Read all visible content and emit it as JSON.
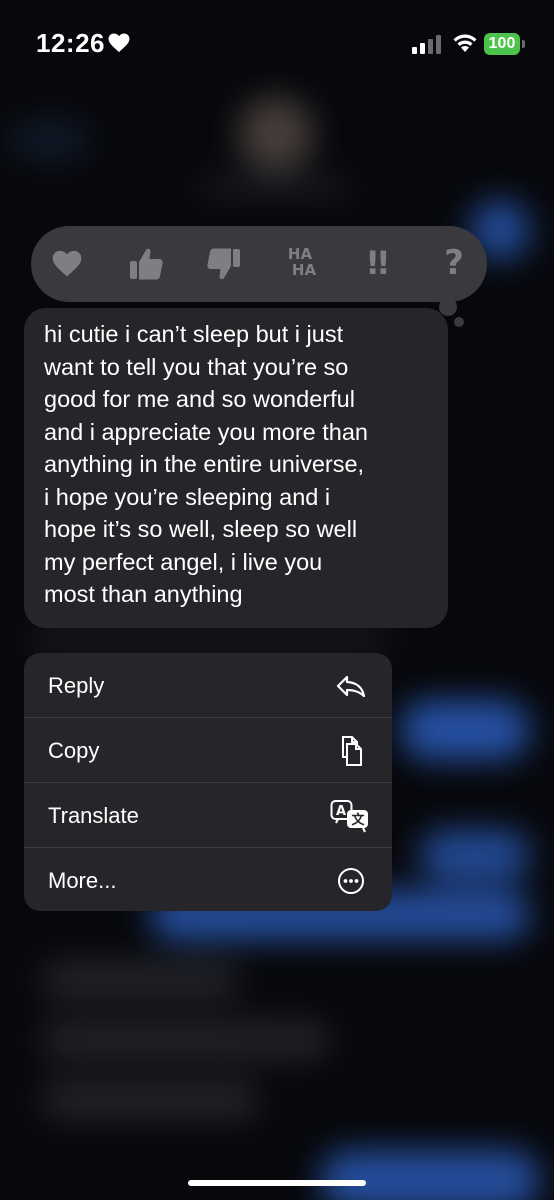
{
  "status_bar": {
    "time": "12:26",
    "time_icon": "heart-icon",
    "battery": "100",
    "battery_color": "#4cc34a"
  },
  "tapbacks": [
    {
      "name": "heart",
      "icon": "heart-icon"
    },
    {
      "name": "thumbs-up",
      "icon": "thumbs-up-icon"
    },
    {
      "name": "thumbs-down",
      "icon": "thumbs-down-icon"
    },
    {
      "name": "haha",
      "line1": "HA",
      "line2": "HA"
    },
    {
      "name": "exclamation",
      "text": "!!"
    },
    {
      "name": "question",
      "text": "?"
    }
  ],
  "message": {
    "text": "hi cutie i can’t sleep but i just\nwant to tell you that you’re so\ngood for me and so wonderful\nand i appreciate you more than\nanything in the entire universe,\ni hope you’re sleeping and i\nhope it’s so well, sleep so well\nmy perfect angel, i live you\nmost than anything"
  },
  "context_menu": {
    "items": [
      {
        "label": "Reply",
        "icon": "reply-arrow-icon"
      },
      {
        "label": "Copy",
        "icon": "copy-icon"
      },
      {
        "label": "Translate",
        "icon": "translate-icon"
      },
      {
        "label": "More...",
        "icon": "more-ellipsis-icon"
      }
    ]
  },
  "colors": {
    "bubble": "#26262a",
    "tapback_bar": "#3a3a3e",
    "icon_gray": "#7e7e84",
    "sent_blue": "#2d63c8"
  }
}
